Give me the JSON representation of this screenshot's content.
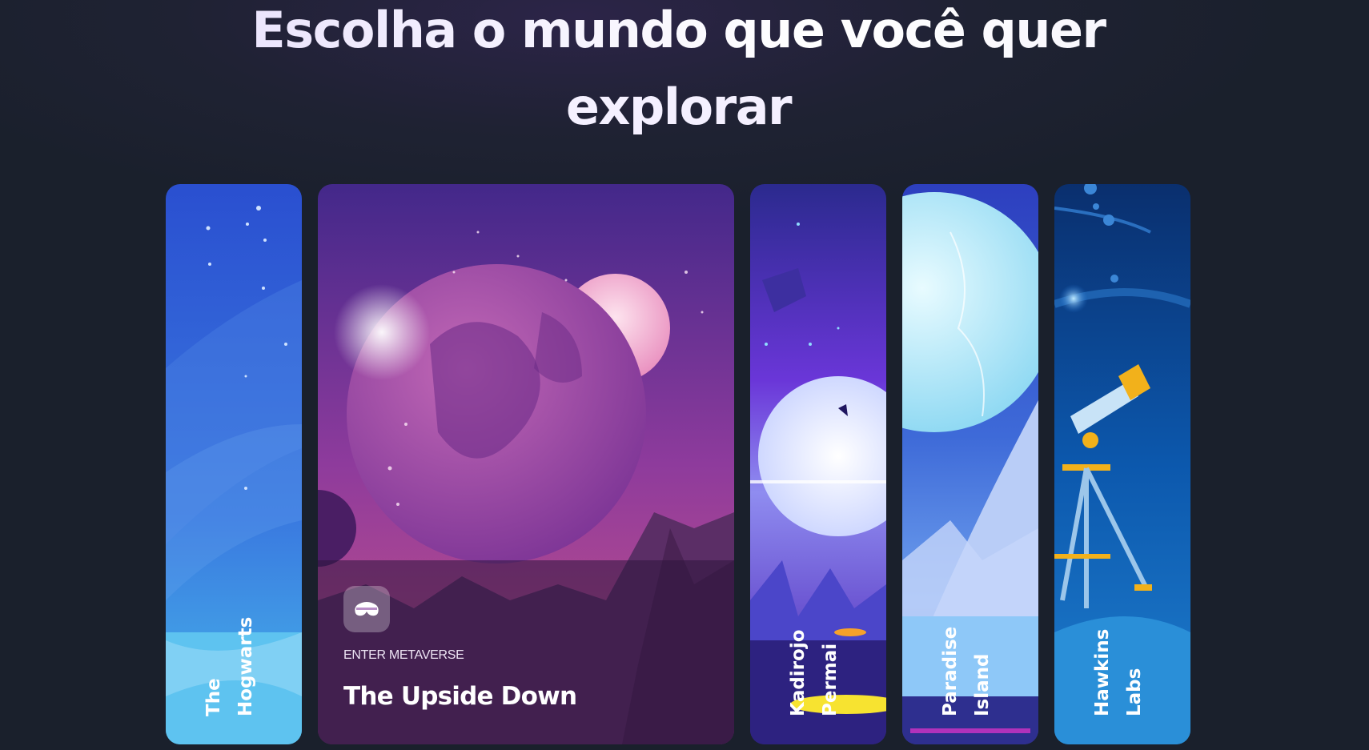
{
  "page": {
    "heading_line1": "Escolha o mundo que você quer",
    "heading_line2": "explorar"
  },
  "worlds": [
    {
      "label_line1": "The",
      "label_line2": "Hogwarts",
      "expanded": false
    },
    {
      "title": "The Upside Down",
      "cta_label": "ENTER METAVERSE",
      "icon": "vr-headset-icon",
      "expanded": true
    },
    {
      "label_line1": "Kadirojo",
      "label_line2": "Permai",
      "expanded": false
    },
    {
      "label_line1": "Paradise",
      "label_line2": "Island",
      "expanded": false
    },
    {
      "label_line1": "Hawkins",
      "label_line2": "Labs",
      "expanded": false
    }
  ],
  "colors": {
    "background": "#1a202c",
    "hogwarts": "#2e5fd6",
    "upside_down": "#7b3aa0",
    "kadirojo": "#5b3fd8",
    "paradise": "#3f7ad8",
    "hawkins": "#0d4fa0"
  }
}
